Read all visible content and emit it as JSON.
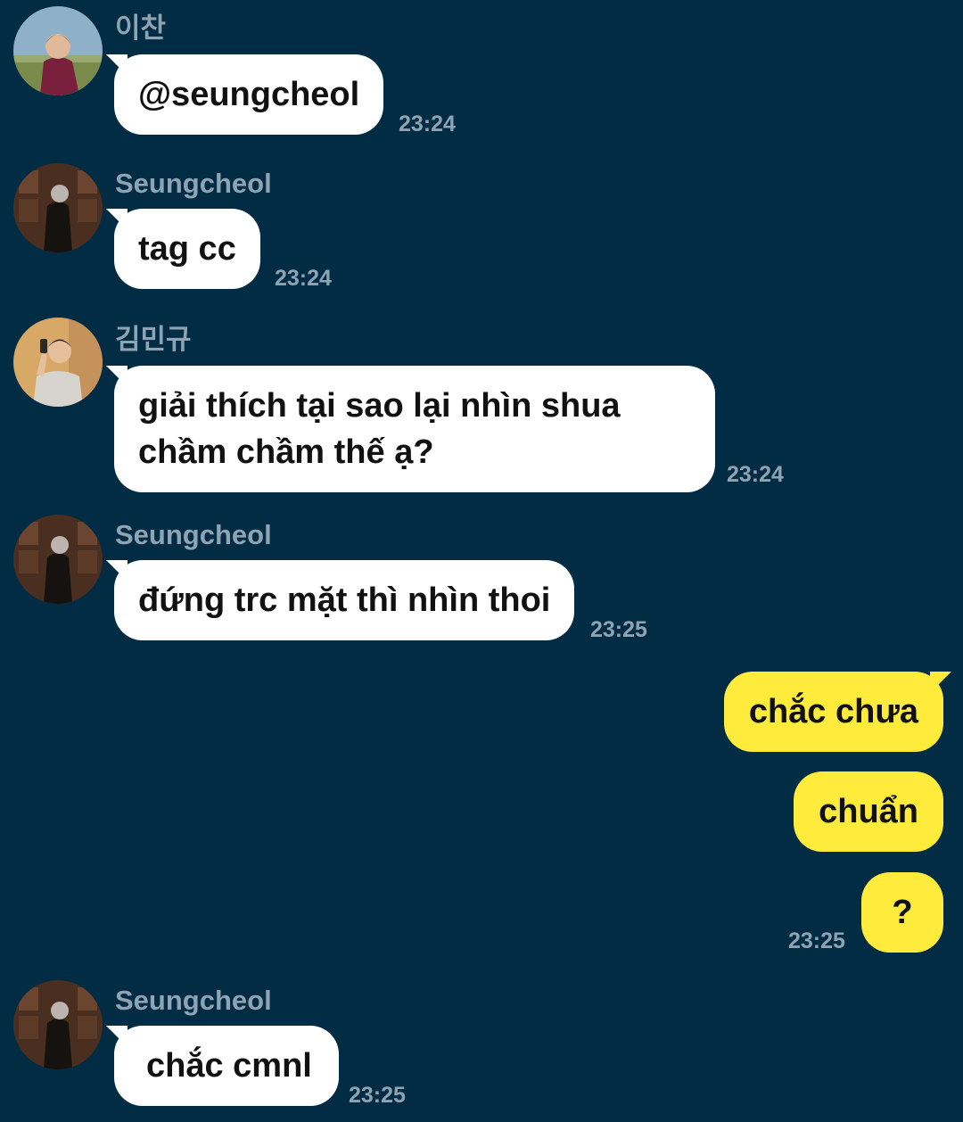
{
  "messages": [
    {
      "sender": "이찬",
      "text": "@seungcheol",
      "time": "23:24",
      "avatar": "avatar-lee-chan"
    },
    {
      "sender": "Seungcheol",
      "text": "tag cc",
      "time": "23:24",
      "avatar": "avatar-seungcheol"
    },
    {
      "sender": "김민규",
      "text": "giải thích tại sao lại nhìn shua chầm chầm thế ạ?",
      "time": "23:24",
      "avatar": "avatar-kim-mingyu"
    },
    {
      "sender": "Seungcheol",
      "text": "đứng trc mặt thì nhìn thoi",
      "time": "23:25",
      "avatar": "avatar-seungcheol"
    },
    {
      "sender": "Seungcheol",
      "text": "chắc cmnl",
      "time": "23:25",
      "avatar": "avatar-seungcheol"
    }
  ],
  "outgoing": {
    "texts": [
      "chắc chưa",
      "chuẩn",
      "?"
    ],
    "time": "23:25"
  },
  "colors": {
    "background": "#022c43",
    "incoming_bubble": "#ffffff",
    "outgoing_bubble": "#ffeb3b",
    "meta_text": "#8ea3b3"
  }
}
